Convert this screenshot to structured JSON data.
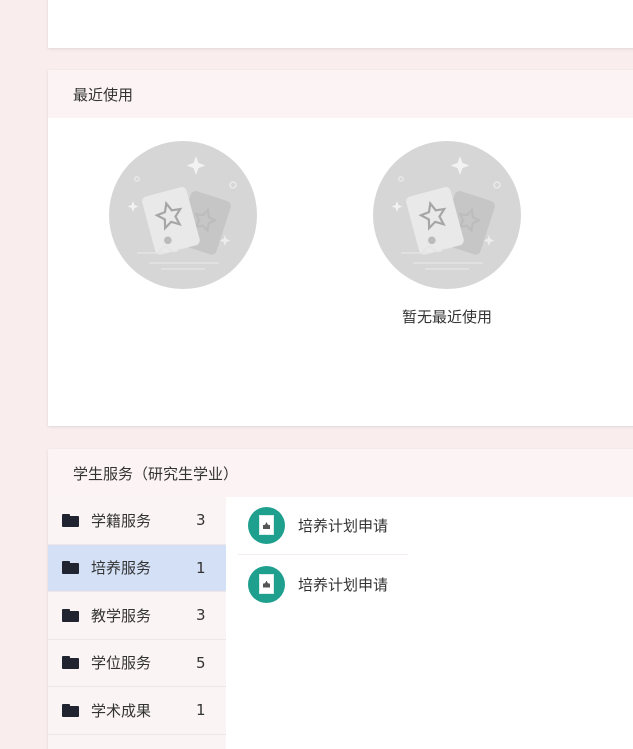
{
  "recent": {
    "title": "最近使用",
    "empty_text": "暂无最近使用"
  },
  "services": {
    "title": "学生服务（研究生学业）",
    "menu": [
      {
        "label": "学籍服务",
        "count": "3",
        "active": false
      },
      {
        "label": "培养服务",
        "count": "1",
        "active": true
      },
      {
        "label": "教学服务",
        "count": "3",
        "active": false
      },
      {
        "label": "学位服务",
        "count": "5",
        "active": false
      },
      {
        "label": "学术成果",
        "count": "1",
        "active": false
      }
    ],
    "items": [
      {
        "label": "培养计划申请"
      },
      {
        "label": "培养计划申请"
      }
    ]
  },
  "colors": {
    "page_bg": "#f9eded",
    "active_menu_bg": "#d3e0f5",
    "service_icon": "#1fa08f"
  },
  "icons": {
    "menu": "folder-icon",
    "service": "document-icon",
    "empty": "empty-cards-illustration"
  }
}
